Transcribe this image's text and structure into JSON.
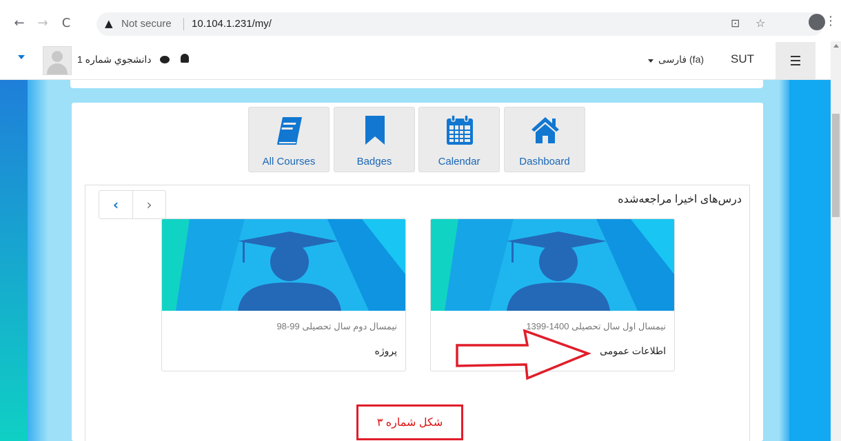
{
  "browser": {
    "back_icon": "arrow-left-icon",
    "forward_icon": "arrow-right-icon",
    "reload_icon": "reload-icon",
    "security_label": "Not secure",
    "url": "10.104.1.231/my/"
  },
  "navbar": {
    "username": "دانشجوي شماره 1",
    "language": "فارسی (fa)",
    "site_name": "SUT"
  },
  "tiles": [
    {
      "label": "All Courses",
      "icon": "book-icon"
    },
    {
      "label": "Badges",
      "icon": "bookmark-icon"
    },
    {
      "label": "Calendar",
      "icon": "calendar-icon"
    },
    {
      "label": "Dashboard",
      "icon": "home-icon"
    }
  ],
  "recent": {
    "title": "درس‌های اخیرا مراجعه‌شده",
    "courses": [
      {
        "category": "نیمسال دوم سال تحصیلی 99-98",
        "name": "پروژه"
      },
      {
        "category": "نیمسال اول سال تحصیلی 1400-1399",
        "name": "اطلاعات عمومی"
      }
    ]
  },
  "annotation": {
    "caption": "شکل شماره ۳",
    "color": "#e11d2a"
  },
  "colors": {
    "link_blue": "#1a67b5",
    "icon_blue": "#1177d1"
  }
}
